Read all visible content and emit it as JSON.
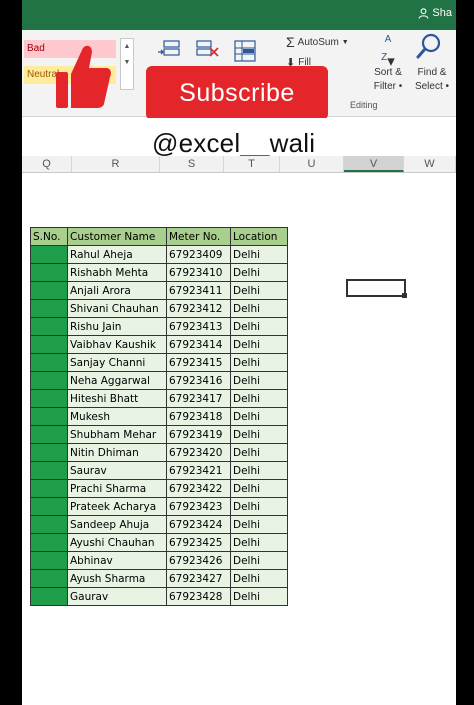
{
  "titlebar": {
    "share_label": "Sha"
  },
  "ribbon": {
    "styles": {
      "bad": "Bad",
      "neutral": "Neutral"
    },
    "autosum": "AutoSum",
    "fill": "Fill",
    "sort_filter": [
      "Sort &",
      "Filter •"
    ],
    "find_select": [
      "Find &",
      "Select •"
    ],
    "group_label": "Editing"
  },
  "overlay": {
    "subscribe": "Subscribe",
    "handle": "@excel__wali"
  },
  "columns": [
    "Q",
    "R",
    "S",
    "T",
    "U",
    "V",
    "W"
  ],
  "selected_column": "V",
  "table": {
    "headers": [
      "S.No.",
      "Customer Name",
      "Meter No.",
      "Location"
    ],
    "rows": [
      [
        "",
        "Rahul Aheja",
        "67923409",
        "Delhi"
      ],
      [
        "",
        "Rishabh Mehta",
        "67923410",
        "Delhi"
      ],
      [
        "",
        "Anjali Arora",
        "67923411",
        "Delhi"
      ],
      [
        "",
        "Shivani Chauhan",
        "67923412",
        "Delhi"
      ],
      [
        "",
        "Rishu Jain",
        "67923413",
        "Delhi"
      ],
      [
        "",
        "Vaibhav Kaushik",
        "67923414",
        "Delhi"
      ],
      [
        "",
        "Sanjay Channi",
        "67923415",
        "Delhi"
      ],
      [
        "",
        "Neha Aggarwal",
        "67923416",
        "Delhi"
      ],
      [
        "",
        "Hiteshi Bhatt",
        "67923417",
        "Delhi"
      ],
      [
        "",
        "Mukesh",
        "67923418",
        "Delhi"
      ],
      [
        "",
        "Shubham Mehar",
        "67923419",
        "Delhi"
      ],
      [
        "",
        "Nitin Dhiman",
        "67923420",
        "Delhi"
      ],
      [
        "",
        "Saurav",
        "67923421",
        "Delhi"
      ],
      [
        "",
        "Prachi Sharma",
        "67923422",
        "Delhi"
      ],
      [
        "",
        "Prateek Acharya",
        "67923423",
        "Delhi"
      ],
      [
        "",
        "Sandeep Ahuja",
        "67923424",
        "Delhi"
      ],
      [
        "",
        "Ayushi Chauhan",
        "67923425",
        "Delhi"
      ],
      [
        "",
        "Abhinav",
        "67923426",
        "Delhi"
      ],
      [
        "",
        "Ayush Sharma",
        "67923427",
        "Delhi"
      ],
      [
        "",
        "Gaurav",
        "67923428",
        "Delhi"
      ]
    ]
  },
  "colors": {
    "excel_green": "#217346",
    "header_fill": "#a8cf8e",
    "sno_fill": "#1e9e4a",
    "subscribe_red": "#e4262b"
  }
}
